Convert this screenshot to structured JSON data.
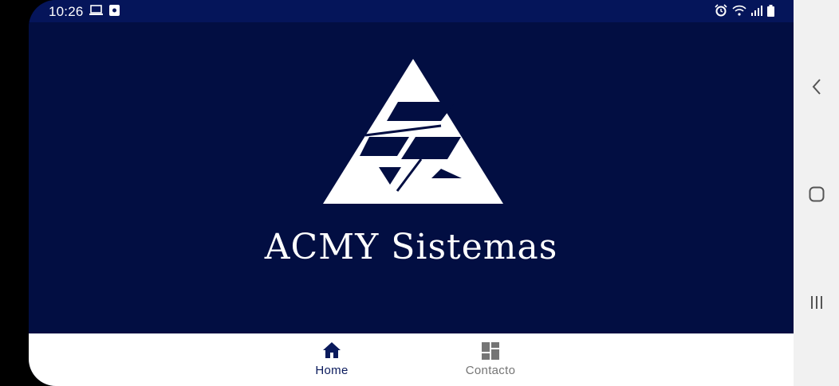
{
  "status_bar": {
    "time": "10:26",
    "left_icons": [
      "laptop-icon",
      "notification-app-icon"
    ],
    "right_icons": [
      "alarm-icon",
      "wifi-icon",
      "signal-icon",
      "battery-icon"
    ]
  },
  "brand": {
    "name": "ACMY Sistemas",
    "logo": "acmy-triangle-logo",
    "background_color": "#020e42"
  },
  "bottom_nav": {
    "items": [
      {
        "label": "Home",
        "icon": "home-icon",
        "active": true
      },
      {
        "label": "Contacto",
        "icon": "dashboard-icon",
        "active": false
      }
    ],
    "active_color": "#0a1a5c",
    "inactive_color": "#757575"
  },
  "system_nav": {
    "buttons": [
      "back-icon",
      "home-circle-icon",
      "recents-icon"
    ]
  }
}
